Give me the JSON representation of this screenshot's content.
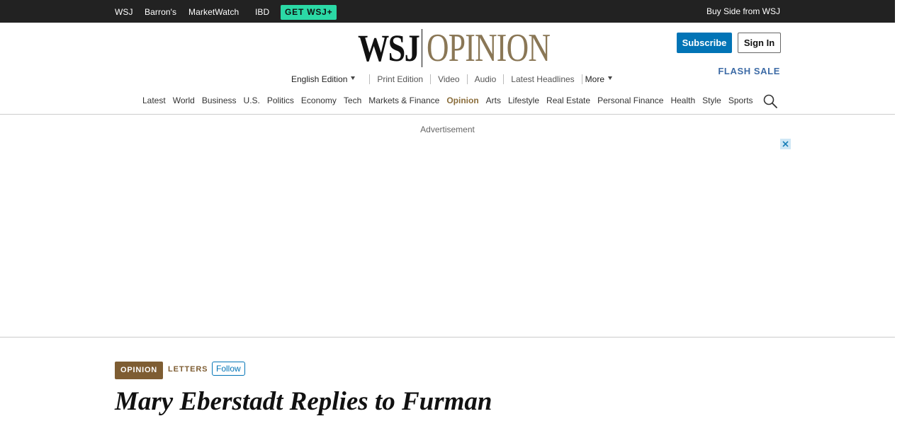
{
  "topbar": {
    "brands": [
      "WSJ",
      "Barron's",
      "MarketWatch",
      "IBD"
    ],
    "cta": "GET WSJ+",
    "right_link": "Buy Side from WSJ"
  },
  "masthead": {
    "logo_left": "WSJ",
    "logo_right": "OPINION",
    "subscribe": "Subscribe",
    "sign_in": "Sign In",
    "flash_sale": "FLASH SALE",
    "subnav": [
      "English Edition",
      "Print Edition",
      "Video",
      "Audio",
      "Latest Headlines",
      "More"
    ]
  },
  "mainnav": [
    "Latest",
    "World",
    "Business",
    "U.S.",
    "Politics",
    "Economy",
    "Tech",
    "Markets & Finance",
    "Opinion",
    "Arts",
    "Lifestyle",
    "Real Estate",
    "Personal Finance",
    "Health",
    "Style",
    "Sports"
  ],
  "ad": {
    "label": "Advertisement"
  },
  "article": {
    "section_tag": "OPINION",
    "category": "LETTERS",
    "follow": "Follow",
    "headline": "Mary Eberstadt Replies to Furman"
  },
  "colors": {
    "accent_brown": "#8a7756",
    "subscribe_blue": "#0274b6",
    "wsj_plus_green": "#2bd9a6"
  },
  "icons": {
    "search": "search-icon",
    "close": "close-icon",
    "caret": "caret-down-icon"
  }
}
